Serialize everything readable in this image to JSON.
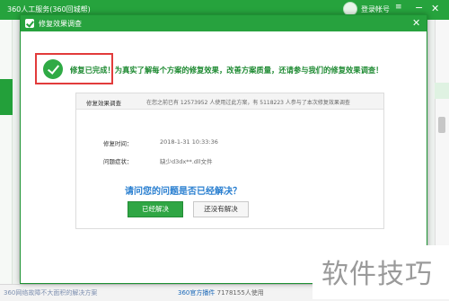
{
  "background_app": {
    "title": "360人工服务(360回城帮)",
    "login_label": "登录帐号",
    "menu_icon": "menu-icon",
    "minimize_icon": "minimize-icon",
    "close_icon": "close-icon",
    "footer_left": "360网络故障不大面积的解决方案",
    "footer_mid_brand": "360官方播件",
    "footer_mid_text": "7178155人使用"
  },
  "dialog": {
    "title": "修复效果调查",
    "headline": "修复已完成！为真实了解每个方案的修复效果，改善方案质量，还请参与我们的修复效果调查！",
    "survey": {
      "title": "修复效果调查",
      "stats": "在您之前已有 12573952 人使用过此方案，有 5118223 人参与了本次修复效果调查",
      "repair_time_label": "修复时间：",
      "repair_time_value": "2018-1-31 10:33:36",
      "symptom_label": "问题症状：",
      "symptom_value": "缺少d3dx**.dll文件",
      "question": "请问您的问题是否已经解决？",
      "yes_button": "已经解决",
      "no_button": "还没有解决"
    }
  },
  "watermark": "软件技巧",
  "colors": {
    "brand_green": "#27a23e",
    "highlight_red": "#e23b3b",
    "question_blue": "#2a7fd0"
  }
}
